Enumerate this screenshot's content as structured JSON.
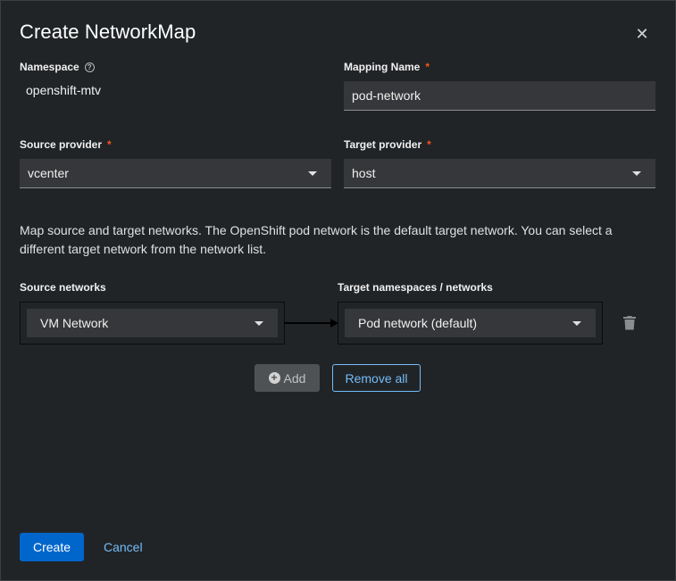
{
  "modal": {
    "title": "Create NetworkMap",
    "close_icon": "close-icon"
  },
  "form": {
    "namespace": {
      "label": "Namespace",
      "value": "openshift-mtv",
      "help_icon": "question-circle-icon"
    },
    "mapping_name": {
      "label": "Mapping Name",
      "required": "*",
      "value": "pod-network"
    },
    "source_provider": {
      "label": "Source provider",
      "required": "*",
      "value": "vcenter"
    },
    "target_provider": {
      "label": "Target provider",
      "required": "*",
      "value": "host"
    }
  },
  "description": "Map source and target networks. The OpenShift pod network is the default target network. You can select a different target network from the network list.",
  "mapping": {
    "source_header": "Source networks",
    "target_header": "Target namespaces / networks",
    "rows": [
      {
        "source": "VM Network",
        "target": "Pod network (default)"
      }
    ],
    "add_label": "Add",
    "remove_all_label": "Remove all"
  },
  "footer": {
    "create_label": "Create",
    "cancel_label": "Cancel"
  },
  "colors": {
    "background": "#212427",
    "primary": "#0066cc",
    "link": "#73bcf7",
    "required": "#f0561d"
  }
}
